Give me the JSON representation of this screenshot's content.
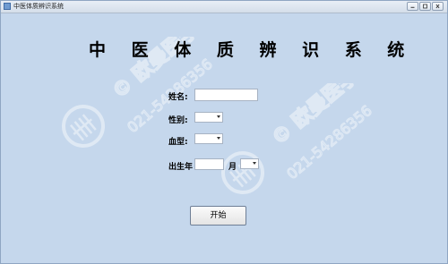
{
  "window": {
    "title": "中医体质辨识系统",
    "controls": [
      "minimize",
      "maximize",
      "close"
    ]
  },
  "main": {
    "heading": "中 医 体 质 辨 识 系 统",
    "form": {
      "name_label": "姓名:",
      "name_value": "",
      "gender_label": "性别:",
      "gender_value": "",
      "blood_label": "血型:",
      "blood_value": "",
      "birth_label": "出生年",
      "birth_year_value": "",
      "month_label": "月",
      "birth_month_value": ""
    },
    "start_button": "开始"
  },
  "watermark": {
    "brand": "© 欧曼医学",
    "phone": "021-54286356"
  },
  "colors": {
    "background": "#c5d7ec",
    "field": "#ffffff"
  }
}
